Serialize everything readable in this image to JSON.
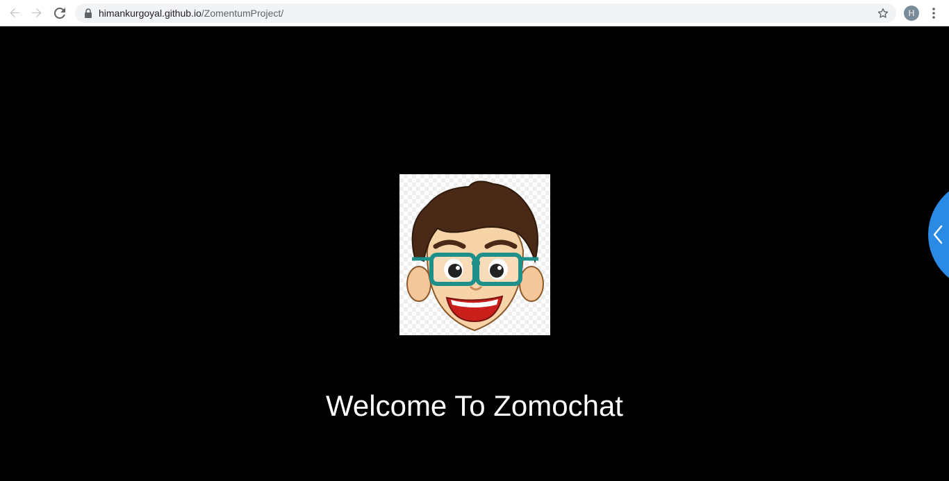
{
  "browser": {
    "url_host": "himankurgoyal.github.io",
    "url_path": "/ZomentumProject/",
    "profile_initial": "H",
    "icons": {
      "back": "arrow-left-icon",
      "forward": "arrow-right-icon",
      "reload": "reload-icon",
      "secure": "lock-icon",
      "bookmark": "star-icon",
      "menu": "kebab-menu-icon"
    }
  },
  "page": {
    "welcome_text": "Welcome To Zomochat",
    "background_color": "#000000",
    "accent_color": "#2b8ae4",
    "side_toggle_icon": "chevron-left-icon",
    "avatar_image": "cartoon-boy-with-glasses"
  }
}
